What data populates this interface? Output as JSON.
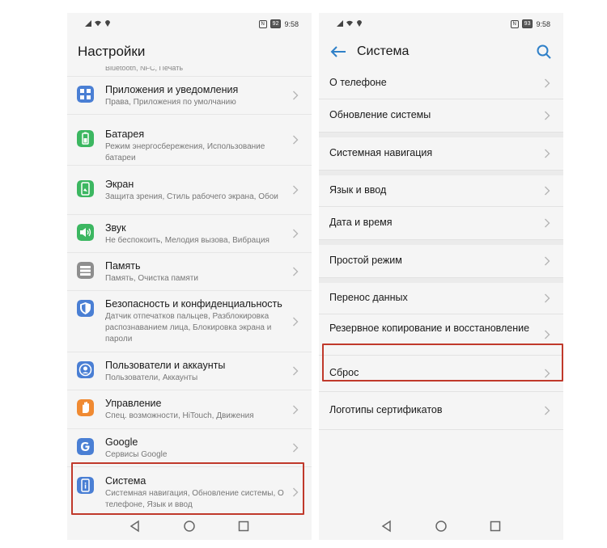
{
  "left_phone": {
    "status": {
      "battery": "92",
      "time": "9:58"
    },
    "title": "Настройки",
    "partial_row_text": "Bluetooth, NFC, Печать",
    "items": [
      {
        "label": "Приложения и уведомления",
        "sub": "Права, Приложения по умолчанию",
        "icon": "apps-icon",
        "color": "#4a7fd4"
      },
      {
        "label": "Батарея",
        "sub": "Режим энергосбережения, Использование батареи",
        "icon": "battery-icon",
        "color": "#3cb761"
      },
      {
        "label": "Экран",
        "sub": "Защита зрения, Стиль рабочего экрана, Обои",
        "icon": "display-icon",
        "color": "#3cb761"
      },
      {
        "label": "Звук",
        "sub": "Не беспокоить, Мелодия вызова, Вибрация",
        "icon": "sound-icon",
        "color": "#3cb761"
      },
      {
        "label": "Память",
        "sub": "Память, Очистка памяти",
        "icon": "storage-icon",
        "color": "#8e8e8e"
      },
      {
        "label": "Безопасность и конфиденциальность",
        "sub": "Датчик отпечатков пальцев, Разблокировка распознаванием лица, Блокировка экрана и пароли",
        "icon": "shield-icon",
        "color": "#4a7fd4"
      },
      {
        "label": "Пользователи и аккаунты",
        "sub": "Пользователи, Аккаунты",
        "icon": "user-icon",
        "color": "#4a7fd4"
      },
      {
        "label": "Управление",
        "sub": "Спец. возможности, HiTouch, Движения",
        "icon": "hand-icon",
        "color": "#f08a32"
      },
      {
        "label": "Google",
        "sub": "Сервисы Google",
        "icon": "google-icon",
        "color": "#4a7fd4"
      },
      {
        "label": "Система",
        "sub": "Системная навигация, Обновление системы, О телефоне, Язык и ввод",
        "icon": "system-icon",
        "color": "#4a7fd4"
      }
    ]
  },
  "right_phone": {
    "status": {
      "battery": "93",
      "time": "9:58"
    },
    "title": "Система",
    "items": [
      {
        "label": "О телефоне"
      },
      {
        "label": "Обновление системы"
      },
      {
        "label": "Системная навигация"
      },
      {
        "label": "Язык и ввод"
      },
      {
        "label": "Дата и время"
      },
      {
        "label": "Простой режим"
      },
      {
        "label": "Перенос данных"
      },
      {
        "label": "Резервное копирование и восстановление"
      },
      {
        "label": "Сброс"
      },
      {
        "label": "Логотипы сертификатов"
      }
    ]
  },
  "colors": {
    "highlight": "#c0392b",
    "accent": "#2f80c8"
  }
}
